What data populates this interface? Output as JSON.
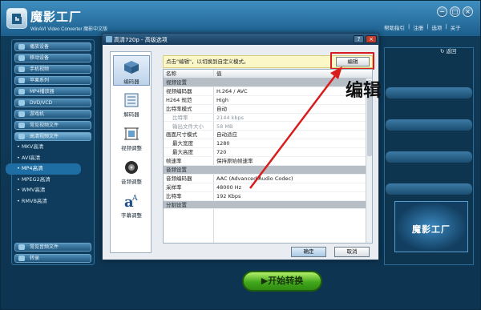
{
  "app": {
    "title": "魔影工厂",
    "subtitle": "WinAVI Video Converter 魔影中文版",
    "top_links": [
      "帮助指引",
      "注册",
      "选项",
      "关于"
    ],
    "window_controls": [
      "−",
      "□",
      "×"
    ]
  },
  "sidebar": {
    "items": [
      "播放设备",
      "移动设备",
      "手机视频",
      "苹果系列",
      "MP4播放器",
      "DVD/VCD",
      "游戏机",
      "常见视频文件",
      "高清视频文件"
    ],
    "sub_items": [
      "MKV高清",
      "AVI高清",
      "MP4高清",
      "MPEG2高清",
      "WMV高清",
      "RMVB高清"
    ],
    "selected_sub": "MP4高清",
    "bottom_items": [
      "常见音频文件",
      "转录"
    ]
  },
  "right_pane": {
    "back_link": "↻ 返回",
    "brand_text": "魔影工厂"
  },
  "start_button": "▶开始转换",
  "dialog": {
    "title": "高清720p - 高级选项",
    "nav": [
      "编码器",
      "解码器",
      "视频调整",
      "音频调整",
      "字幕调整"
    ],
    "hint": "点击\"编辑\"，以切换到自定义模式。",
    "edit_label": "编辑",
    "table_header": {
      "name": "名称",
      "value": "值"
    },
    "rows": [
      {
        "name": "视频设置",
        "value": "",
        "kind": "section"
      },
      {
        "name": "视频编码器",
        "value": "H.264 / AVC",
        "kind": "row"
      },
      {
        "name": "H264 规范",
        "value": "High",
        "kind": "row"
      },
      {
        "name": "比特率模式",
        "value": "自动",
        "kind": "row"
      },
      {
        "name": "比特率",
        "value": "2144 kbps",
        "kind": "dim"
      },
      {
        "name": "输出文件大小",
        "value": "58 MB",
        "kind": "dim"
      },
      {
        "name": "画面尺寸模式",
        "value": "自动适应",
        "kind": "row"
      },
      {
        "name": "最大宽度",
        "value": "1280",
        "kind": "sub"
      },
      {
        "name": "最大高度",
        "value": "720",
        "kind": "sub"
      },
      {
        "name": "帧速率",
        "value": "保持原始帧速率",
        "kind": "row"
      },
      {
        "name": "音频设置",
        "value": "",
        "kind": "section"
      },
      {
        "name": "音频编码器",
        "value": "AAC (Advanced Audio Codec)",
        "kind": "row"
      },
      {
        "name": "采样率",
        "value": "48000 Hz",
        "kind": "row"
      },
      {
        "name": "比特率",
        "value": "192 Kbps",
        "kind": "row"
      },
      {
        "name": "分割设置",
        "value": "",
        "kind": "section"
      }
    ],
    "ok_label": "确定",
    "cancel_label": "取消"
  },
  "annotation": {
    "label": "编辑",
    "color": "#d91c1c"
  }
}
